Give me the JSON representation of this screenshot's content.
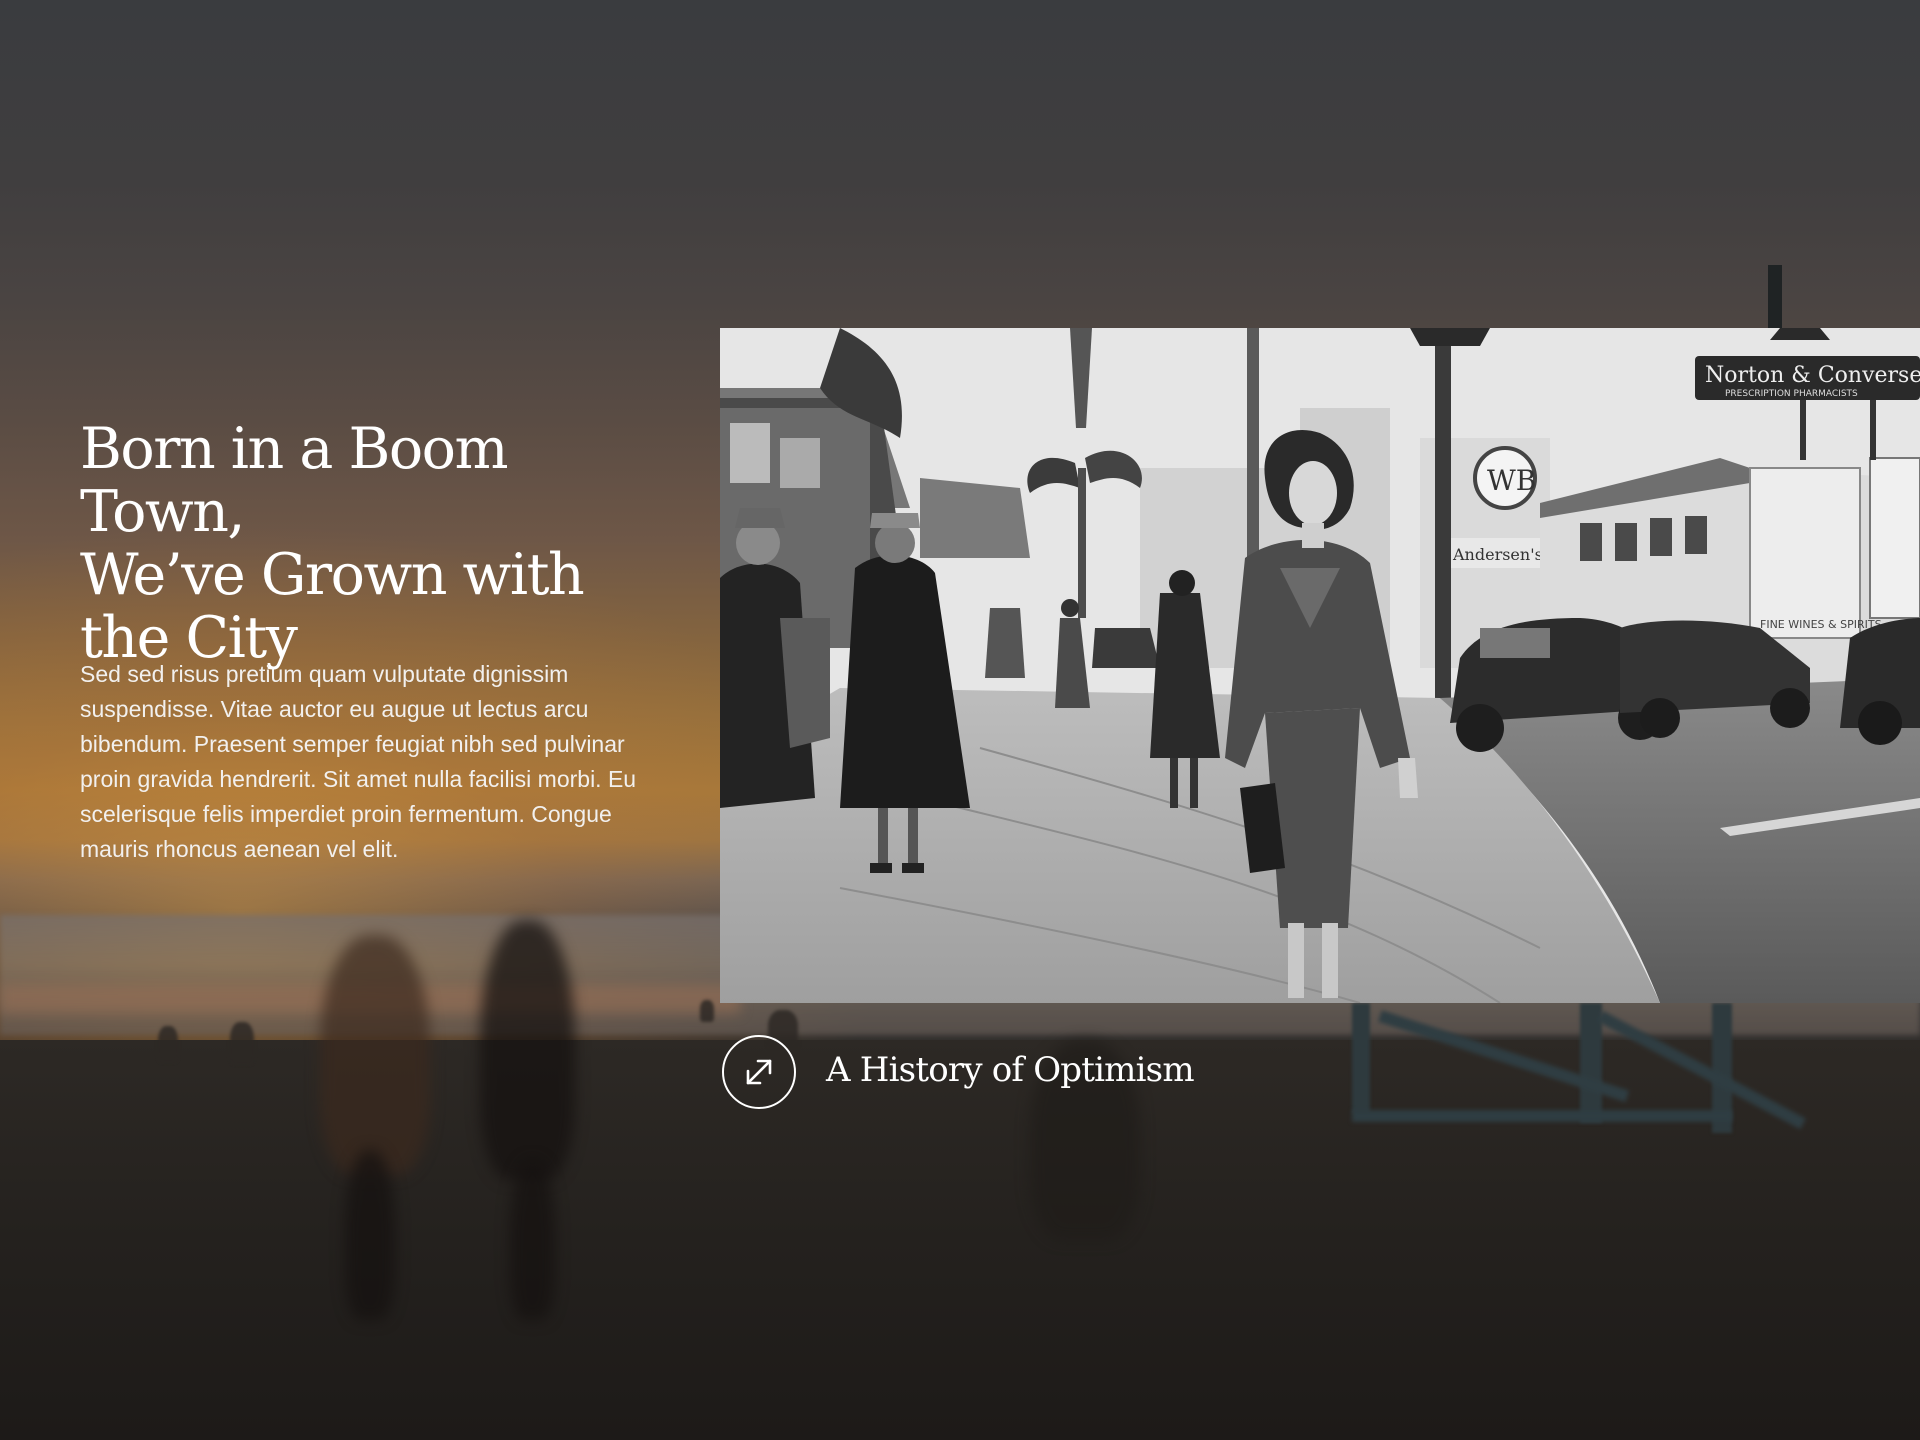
{
  "hero": {
    "title_lines": [
      "Born in a Boom Town,",
      "We’ve Grown with",
      "the City"
    ],
    "body": "Sed sed risus pretium quam vulputate dignissim suspendisse. Vitae auctor eu augue ut lectus arcu bibendum. Praesent semper feugiat nibh sed pulvinar proin gravida hendrerit. Sit amet nulla facilisi morbi. Eu scelerisque felis imperdiet proin fermentum. Congue mauris rhoncus aenean vel elit."
  },
  "media": {
    "photo_style": "black-and-white vintage street photograph",
    "signs": {
      "pharmacy": "Norton & Converse",
      "pharmacy_sub": "PRESCRIPTION PHARMACISTS",
      "theater": "WB",
      "store": "Andersen's",
      "wines": "FINE WINES & SPIRITS"
    },
    "caption": "A History of Optimism",
    "expand_icon": "expand-arrows-icon"
  },
  "colors": {
    "text": "#ffffff",
    "sky_top": "#3a3c3f",
    "sunset": "#a5783a",
    "sand": "#24211e"
  }
}
